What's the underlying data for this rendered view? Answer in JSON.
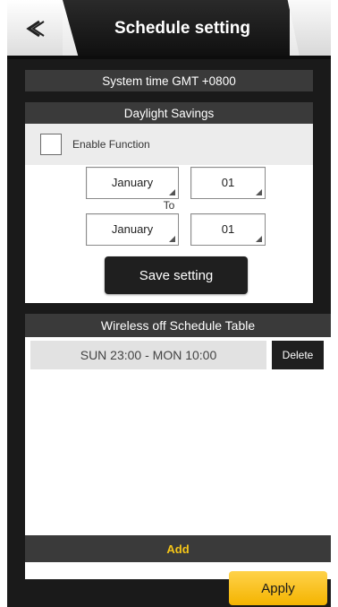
{
  "header": {
    "title": "Schedule setting",
    "back_icon": "double-chevron-left-icon"
  },
  "system_time": {
    "text": "System time GMT +0800"
  },
  "daylight": {
    "title": "Daylight Savings",
    "enable_label": "Enable Function",
    "enable_checked": false,
    "start_month": "January",
    "start_day": "01",
    "to_label": "To",
    "end_month": "January",
    "end_day": "01",
    "save_label": "Save setting"
  },
  "wireless": {
    "title": "Wireless off Schedule Table",
    "rows": [
      {
        "schedule": "SUN 23:00 - MON 10:00",
        "delete_label": "Delete"
      }
    ],
    "add_label": "Add"
  },
  "apply_label": "Apply",
  "colors": {
    "accent": "#f4b400",
    "add_text": "#f5c518",
    "bar": "#3a3a3a",
    "background": "#1a1a1a"
  }
}
